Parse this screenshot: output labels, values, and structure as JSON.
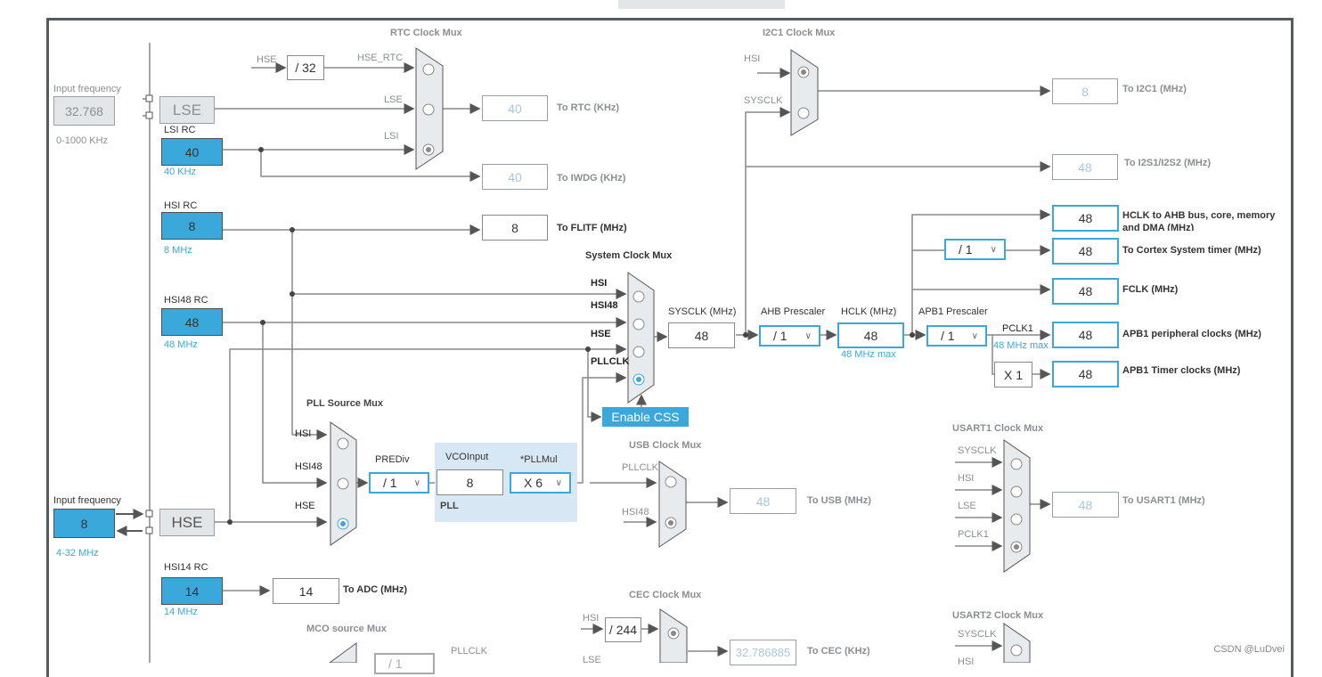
{
  "watermark": "CSDN @LuDvei",
  "lse": {
    "title": "Input frequency",
    "value": "32.768",
    "range": "0-1000 KHz",
    "label": "LSE"
  },
  "lsi": {
    "title": "LSI RC",
    "value": "40",
    "unit": "40 KHz"
  },
  "hsi": {
    "title": "HSI RC",
    "value": "8",
    "unit": "8 MHz"
  },
  "hsi48": {
    "title": "HSI48 RC",
    "value": "48",
    "unit": "48 MHz"
  },
  "hse": {
    "title": "Input frequency",
    "value": "8",
    "range": "4-32 MHz",
    "label": "HSE"
  },
  "hsi14": {
    "title": "HSI14 RC",
    "value": "14",
    "unit": "14 MHz"
  },
  "rtc_mux": {
    "title": "RTC Clock Mux",
    "inputs": [
      "HSE_RTC",
      "LSE",
      "LSI"
    ],
    "hse_label": "HSE",
    "div": "/ 32",
    "selected": "LSI"
  },
  "outputs": {
    "rtc": {
      "value": "40",
      "label": "To RTC (KHz)"
    },
    "iwdg": {
      "value": "40",
      "label": "To IWDG (KHz)"
    },
    "flitf": {
      "value": "8",
      "label": "To FLITF (MHz)"
    },
    "adc": {
      "value": "14",
      "label": "To ADC (MHz)"
    },
    "i2c1": {
      "value": "8",
      "label": "To I2C1 (MHz)"
    },
    "i2s": {
      "value": "48",
      "label": "To I2S1/I2S2 (MHz)"
    },
    "hclk_ahb": {
      "value": "48",
      "label": "HCLK to AHB bus, core, memory and DMA (MHz)"
    },
    "cortex": {
      "value": "48",
      "label": "To Cortex System timer (MHz)"
    },
    "fclk": {
      "value": "48",
      "label": "FCLK (MHz)"
    },
    "apb1_periph": {
      "value": "48",
      "label": "APB1 peripheral clocks (MHz)"
    },
    "apb1_timer": {
      "value": "48",
      "label": "APB1 Timer clocks (MHz)"
    },
    "usb": {
      "value": "48",
      "label": "To USB (MHz)"
    },
    "usart1": {
      "value": "48",
      "label": "To USART1 (MHz)"
    },
    "cec": {
      "value": "32.786885",
      "label": "To CEC (KHz)"
    }
  },
  "i2c1_mux": {
    "title": "I2C1 Clock Mux",
    "inputs": [
      "HSI",
      "SYSCLK"
    ],
    "selected": "HSI"
  },
  "sys_mux": {
    "title": "System Clock Mux",
    "inputs": [
      "HSI",
      "HSI48",
      "HSE",
      "PLLCLK"
    ],
    "selected": "PLLCLK"
  },
  "sysclk": {
    "label": "SYSCLK (MHz)",
    "value": "48"
  },
  "ahb": {
    "label": "AHB Prescaler",
    "value": "/ 1"
  },
  "hclk": {
    "label": "HCLK (MHz)",
    "value": "48",
    "max": "48 MHz max"
  },
  "apb1": {
    "label": "APB1 Prescaler",
    "value": "/ 1",
    "pclk": "PCLK1",
    "max": "48 MHz max",
    "timer_mul": "X 1"
  },
  "cortex_div": "/ 1",
  "css_button": "Enable CSS",
  "pll_mux": {
    "title": "PLL Source Mux",
    "inputs": [
      "HSI",
      "HSI48",
      "HSE"
    ],
    "selected": "HSE"
  },
  "pll": {
    "prediv_label": "PREDiv",
    "prediv": "/ 1",
    "vco_label": "VCOInput",
    "vco": "8",
    "mul_label": "*PLLMul",
    "mul": "X 6",
    "name": "PLL"
  },
  "usb_mux": {
    "title": "USB Clock Mux",
    "inputs": [
      "PLLCLK",
      "HSI48"
    ],
    "selected": "HSI48"
  },
  "usart1_mux": {
    "title": "USART1 Clock Mux",
    "inputs": [
      "SYSCLK",
      "HSI",
      "LSE",
      "PCLK1"
    ],
    "selected": "PCLK1"
  },
  "cec_mux": {
    "title": "CEC Clock Mux",
    "inputs": [
      "HSI",
      "LSE"
    ],
    "div": "/ 244",
    "selected": "HSI"
  },
  "mco_mux": {
    "title": "MCO source Mux",
    "input": "PLLCLK",
    "div": "/ 1"
  },
  "usart2_mux": {
    "title": "USART2 Clock Mux",
    "inputs": [
      "SYSCLK",
      "HSI"
    ]
  }
}
